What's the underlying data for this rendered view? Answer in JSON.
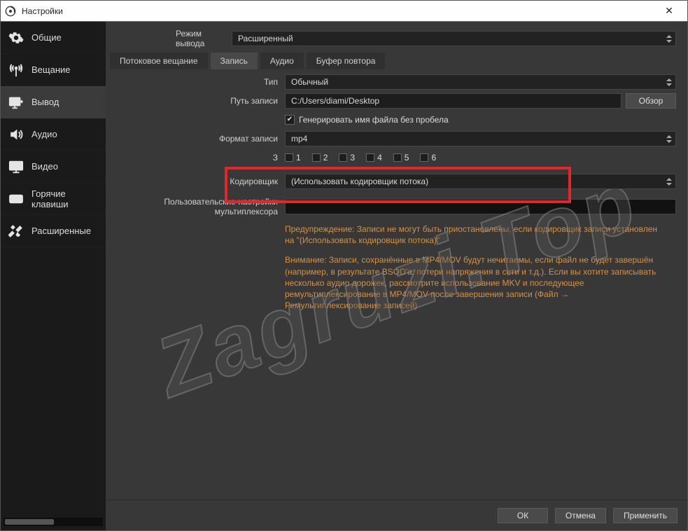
{
  "window": {
    "title": "Настройки"
  },
  "sidebar": {
    "items": [
      {
        "label": "Общие"
      },
      {
        "label": "Вещание"
      },
      {
        "label": "Вывод"
      },
      {
        "label": "Аудио"
      },
      {
        "label": "Видео"
      },
      {
        "label": "Горячие клавиши"
      },
      {
        "label": "Расширенные"
      }
    ]
  },
  "main": {
    "output_mode_label": "Режим вывода",
    "output_mode_value": "Расширенный",
    "tabs": [
      {
        "label": "Потоковое вещание"
      },
      {
        "label": "Запись"
      },
      {
        "label": "Аудио"
      },
      {
        "label": "Буфер повтора"
      }
    ],
    "type_label": "Тип",
    "type_value": "Обычный",
    "rec_path_label": "Путь записи",
    "rec_path_value": "C:/Users/diami/Desktop",
    "browse_label": "Обзор",
    "no_space_label": "Генерировать имя файла без пробела",
    "rec_format_label": "Формат записи",
    "rec_format_value": "mp4",
    "tracks_cut_label": "З",
    "tracks": [
      "1",
      "2",
      "3",
      "4",
      "5",
      "6"
    ],
    "encoder_label": "Кодировщик",
    "encoder_value": "(Использовать кодировщик потока)",
    "mux_label": "Пользовательские настройки мультиплексора",
    "warn1": "Предупреждение: Записи не могут быть приостановлены, если кодировщик записи установлен на \"(Использовать кодировщик потока)\"",
    "warn2": "Внимание: Записи, сохранённые в MP4/MOV будут нечитаемы, если файл не будет завершён (например, в результате BSOD'а, потери напряжения в сети и т.д.). Если вы хотите записывать несколько аудио дорожек, рассмотрите использование MKV и последующее ремультиплексирование в MP4/MOV после завершения записи (Файл → Ремультиплексирование записей)"
  },
  "footer": {
    "ok": "ОК",
    "cancel": "Отмена",
    "apply": "Применить"
  },
  "watermark": "Zagruzi.Top"
}
